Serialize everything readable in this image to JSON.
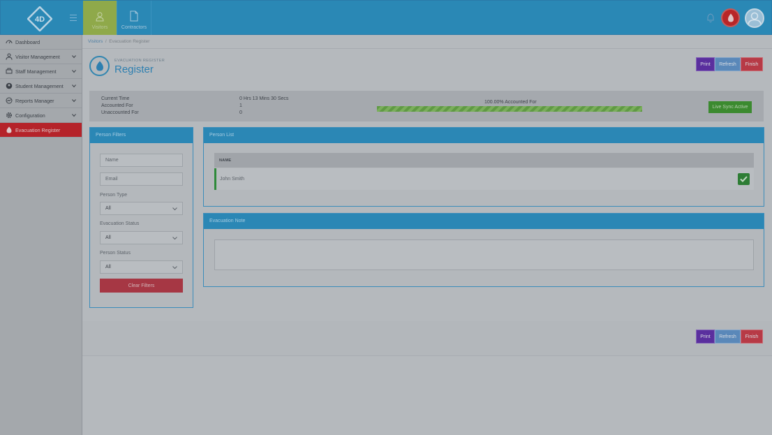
{
  "topbar": {
    "nav": [
      {
        "label": "Visitors",
        "icon": "person-icon",
        "active": true
      },
      {
        "label": "Contractors",
        "icon": "document-icon",
        "active": false
      }
    ]
  },
  "sidebar": {
    "items": [
      {
        "label": "Dashboard",
        "icon": "dashboard-icon"
      },
      {
        "label": "Visitor Management",
        "icon": "person-icon"
      },
      {
        "label": "Staff Management",
        "icon": "staff-icon"
      },
      {
        "label": "Student Management",
        "icon": "student-icon"
      },
      {
        "label": "Reports Manager",
        "icon": "reports-icon"
      },
      {
        "label": "Configuration",
        "icon": "gear-icon"
      },
      {
        "label": "Evacuation Register",
        "icon": "flame-icon"
      }
    ]
  },
  "breadcrumb": {
    "link": "Visitors",
    "separator": "/",
    "current": "Evacuation Register"
  },
  "header": {
    "subtitle": "EVACUATION REGISTER",
    "title": "Register"
  },
  "actions": {
    "print": "Print",
    "refresh": "Refresh",
    "finish": "Finish"
  },
  "stats": {
    "current_time_label": "Current Time",
    "current_time_value": "0 Hrs 13 Mins 30 Secs",
    "accounted_label": "Accounted For",
    "accounted_value": "1",
    "unaccounted_label": "Unaccounted For",
    "unaccounted_value": "0",
    "progress_label": "100.00% Accounted For",
    "progress_fraction": 1.0,
    "sync_label": "Live Sync Active"
  },
  "filters": {
    "title": "Person Filters",
    "name_placeholder": "Name",
    "email_placeholder": "Email",
    "person_type_label": "Person Type",
    "person_type_value": "All",
    "evac_status_label": "Evacuation Status",
    "evac_status_value": "All",
    "person_status_label": "Person Status",
    "person_status_value": "All",
    "clear_label": "Clear Filters"
  },
  "person_list": {
    "title": "Person List",
    "column_name": "NAME",
    "rows": [
      {
        "name": "John Smith",
        "accounted": true
      }
    ]
  },
  "evac_note": {
    "title": "Evacuation Note"
  },
  "colors": {
    "primary": "#2b87b5",
    "danger": "#b5232a",
    "success": "#2e7d35",
    "print": "#5a2f9e"
  }
}
